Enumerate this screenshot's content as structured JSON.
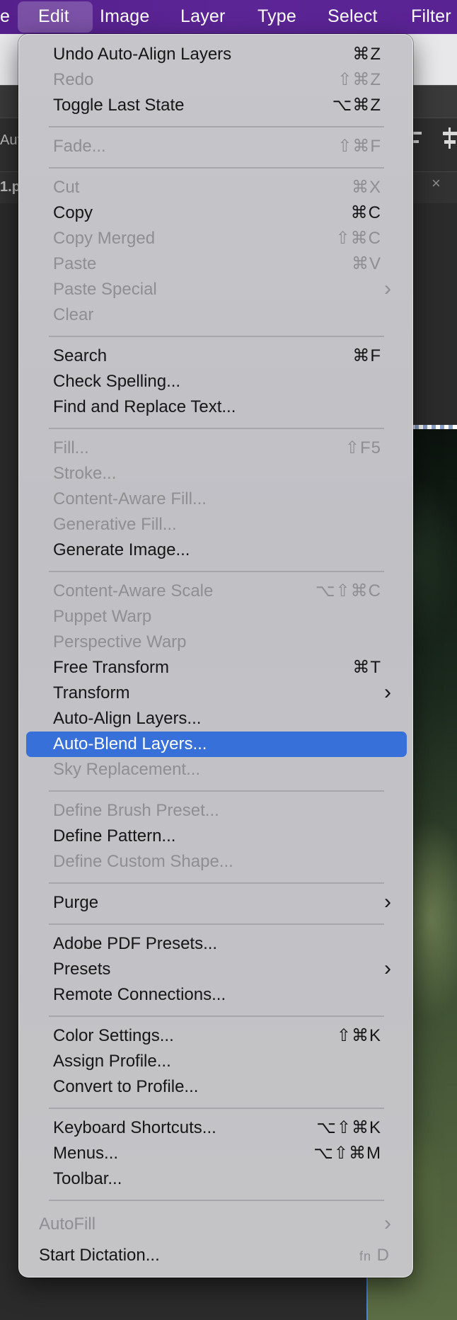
{
  "menubar": {
    "items": [
      {
        "label": "e"
      },
      {
        "label": "Edit"
      },
      {
        "label": "Image"
      },
      {
        "label": "Layer"
      },
      {
        "label": "Type"
      },
      {
        "label": "Select"
      },
      {
        "label": "Filter"
      }
    ],
    "active": "Edit"
  },
  "background": {
    "toolbar_fragment": "Aut",
    "tab_fragment": "1.p",
    "close_glyph": "×"
  },
  "edit_menu": {
    "items": {
      "undo": {
        "label": "Undo Auto-Align Layers",
        "shortcut": "⌘Z",
        "enabled": true
      },
      "redo": {
        "label": "Redo",
        "shortcut": "⇧⌘Z",
        "enabled": false
      },
      "toggle_last_state": {
        "label": "Toggle Last State",
        "shortcut": "⌥⌘Z",
        "enabled": true
      },
      "fade": {
        "label": "Fade...",
        "shortcut": "⇧⌘F",
        "enabled": false
      },
      "cut": {
        "label": "Cut",
        "shortcut": "⌘X",
        "enabled": false
      },
      "copy": {
        "label": "Copy",
        "shortcut": "⌘C",
        "enabled": true
      },
      "copy_merged": {
        "label": "Copy Merged",
        "shortcut": "⇧⌘C",
        "enabled": false
      },
      "paste": {
        "label": "Paste",
        "shortcut": "⌘V",
        "enabled": false
      },
      "paste_special": {
        "label": "Paste Special",
        "submenu": true,
        "enabled": false
      },
      "clear": {
        "label": "Clear",
        "enabled": false
      },
      "search": {
        "label": "Search",
        "shortcut": "⌘F",
        "enabled": true
      },
      "check_spelling": {
        "label": "Check Spelling...",
        "enabled": true
      },
      "find_replace": {
        "label": "Find and Replace Text...",
        "enabled": true
      },
      "fill": {
        "label": "Fill...",
        "shortcut": "⇧F5",
        "enabled": false
      },
      "stroke": {
        "label": "Stroke...",
        "enabled": false
      },
      "content_aware_fill": {
        "label": "Content-Aware Fill...",
        "enabled": false
      },
      "generative_fill": {
        "label": "Generative Fill...",
        "enabled": false
      },
      "generate_image": {
        "label": "Generate Image...",
        "enabled": true
      },
      "content_aware_scale": {
        "label": "Content-Aware Scale",
        "shortcut": "⌥⇧⌘C",
        "enabled": false
      },
      "puppet_warp": {
        "label": "Puppet Warp",
        "enabled": false
      },
      "perspective_warp": {
        "label": "Perspective Warp",
        "enabled": false
      },
      "free_transform": {
        "label": "Free Transform",
        "shortcut": "⌘T",
        "enabled": true
      },
      "transform": {
        "label": "Transform",
        "submenu": true,
        "enabled": true
      },
      "auto_align": {
        "label": "Auto-Align Layers...",
        "enabled": true
      },
      "auto_blend": {
        "label": "Auto-Blend Layers...",
        "enabled": true,
        "highlighted": true
      },
      "sky_replacement": {
        "label": "Sky Replacement...",
        "enabled": false
      },
      "define_brush": {
        "label": "Define Brush Preset...",
        "enabled": false
      },
      "define_pattern": {
        "label": "Define Pattern...",
        "enabled": true
      },
      "define_custom_shape": {
        "label": "Define Custom Shape...",
        "enabled": false
      },
      "purge": {
        "label": "Purge",
        "submenu": true,
        "enabled": true
      },
      "pdf_presets": {
        "label": "Adobe PDF Presets...",
        "enabled": true
      },
      "presets": {
        "label": "Presets",
        "submenu": true,
        "enabled": true
      },
      "remote_connections": {
        "label": "Remote Connections...",
        "enabled": true
      },
      "color_settings": {
        "label": "Color Settings...",
        "shortcut": "⇧⌘K",
        "enabled": true
      },
      "assign_profile": {
        "label": "Assign Profile...",
        "enabled": true
      },
      "convert_profile": {
        "label": "Convert to Profile...",
        "enabled": true
      },
      "keyboard_shortcuts": {
        "label": "Keyboard Shortcuts...",
        "shortcut": "⌥⇧⌘K",
        "enabled": true
      },
      "menus": {
        "label": "Menus...",
        "shortcut": "⌥⇧⌘M",
        "enabled": true
      },
      "toolbar": {
        "label": "Toolbar...",
        "enabled": true
      },
      "autofill": {
        "label": "AutoFill",
        "submenu": true,
        "enabled": false
      },
      "start_dictation": {
        "label": "Start Dictation...",
        "shortcut_prefix": "fn",
        "shortcut": "D",
        "enabled": true
      }
    }
  },
  "icons": {
    "submenu_arrow": "›"
  },
  "colors": {
    "menubar": "#5a2394",
    "highlight": "#3670d8",
    "menu_bg": "#c4c4c7",
    "disabled_text": "#8e8e93"
  }
}
